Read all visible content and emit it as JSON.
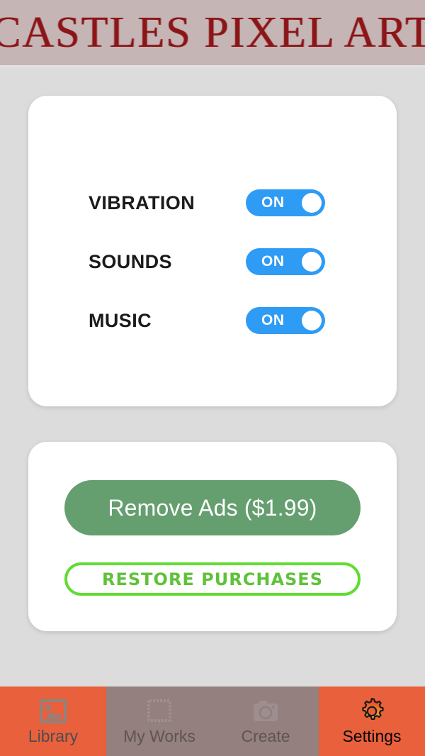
{
  "header": {
    "title": "CASTLES PIXEL ART",
    "background_color": "#c5b5b5",
    "title_color": "#8c1518"
  },
  "page": {
    "background_color": "#dcdcdc",
    "card_background_color": "#ffffff"
  },
  "settings_card": {
    "rows": [
      {
        "label": "VIBRATION",
        "state": "ON",
        "icon": "toggle-switch-on"
      },
      {
        "label": "SOUNDS",
        "state": "ON",
        "icon": "toggle-switch-on"
      },
      {
        "label": "MUSIC",
        "state": "ON",
        "icon": "toggle-switch-on"
      }
    ],
    "toggle_on_color": "#2e9bf5",
    "toggle_knob_color": "#ffffff"
  },
  "purchases_card": {
    "remove_ads_label": "Remove Ads ($1.99)",
    "remove_ads_color": "#659e6f",
    "restore_label": "RESTORE PURCHASES",
    "restore_border_color": "#5fdd33",
    "restore_text_color": "#5fc23a"
  },
  "bottom_nav": {
    "active_background_color": "#e8603c",
    "dimmed_background_color": "#93807f",
    "tabs": [
      {
        "label": "Library",
        "icon": "image-icon",
        "state": "inactive",
        "dimmed": false
      },
      {
        "label": "My Works",
        "icon": "stamp-frame-icon",
        "state": "inactive",
        "dimmed": true
      },
      {
        "label": "Create",
        "icon": "camera-icon",
        "state": "inactive",
        "dimmed": true
      },
      {
        "label": "Settings",
        "icon": "gear-icon",
        "state": "active",
        "dimmed": false
      }
    ]
  }
}
